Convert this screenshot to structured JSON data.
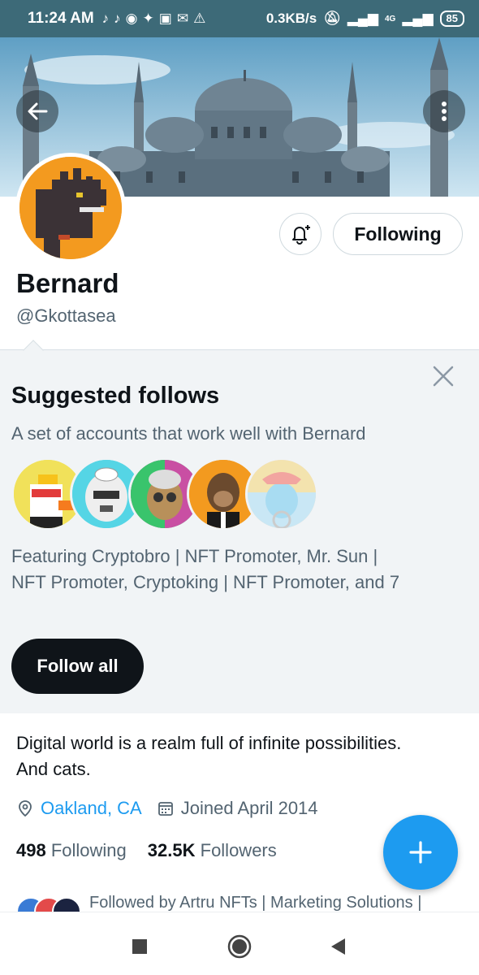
{
  "status_bar": {
    "time": "11:24 AM",
    "app_icons": [
      "tiktok-icon",
      "tiktok-icon",
      "messenger-icon",
      "twitter-icon",
      "app-icon",
      "gmail-icon",
      "warning-icon"
    ],
    "net_speed": "0.3KB/s",
    "network": "4G",
    "battery": "85"
  },
  "banner": {
    "sky": "#7fb8d6",
    "building": "#5a6f7e"
  },
  "profile": {
    "display_name": "Bernard",
    "handle": "@Gkottasea",
    "following_label": "Following"
  },
  "suggested": {
    "title": "Suggested follows",
    "subtitle": "A set of accounts that work well with Bernard",
    "featuring_line1": "Featuring Cryptobro | NFT Promoter, Mr. Sun |",
    "featuring_line2": "NFT Promoter, Cryptoking | NFT Promoter, and 7",
    "follow_all_label": "Follow all"
  },
  "bio": {
    "line1": "Digital world is a realm full of infinite possibilities.",
    "line2": "And cats.",
    "location": "Oakland, CA",
    "joined": "Joined April 2014"
  },
  "stats": {
    "following_count": "498",
    "following_label": "Following",
    "followers_count": "32.5K",
    "followers_label": "Followers"
  },
  "followed_by": "Followed by Artru NFTs | Marketing Solutions |",
  "colors": {
    "accent": "#1d9bf0",
    "text": "#0f1419",
    "muted": "#536471"
  }
}
